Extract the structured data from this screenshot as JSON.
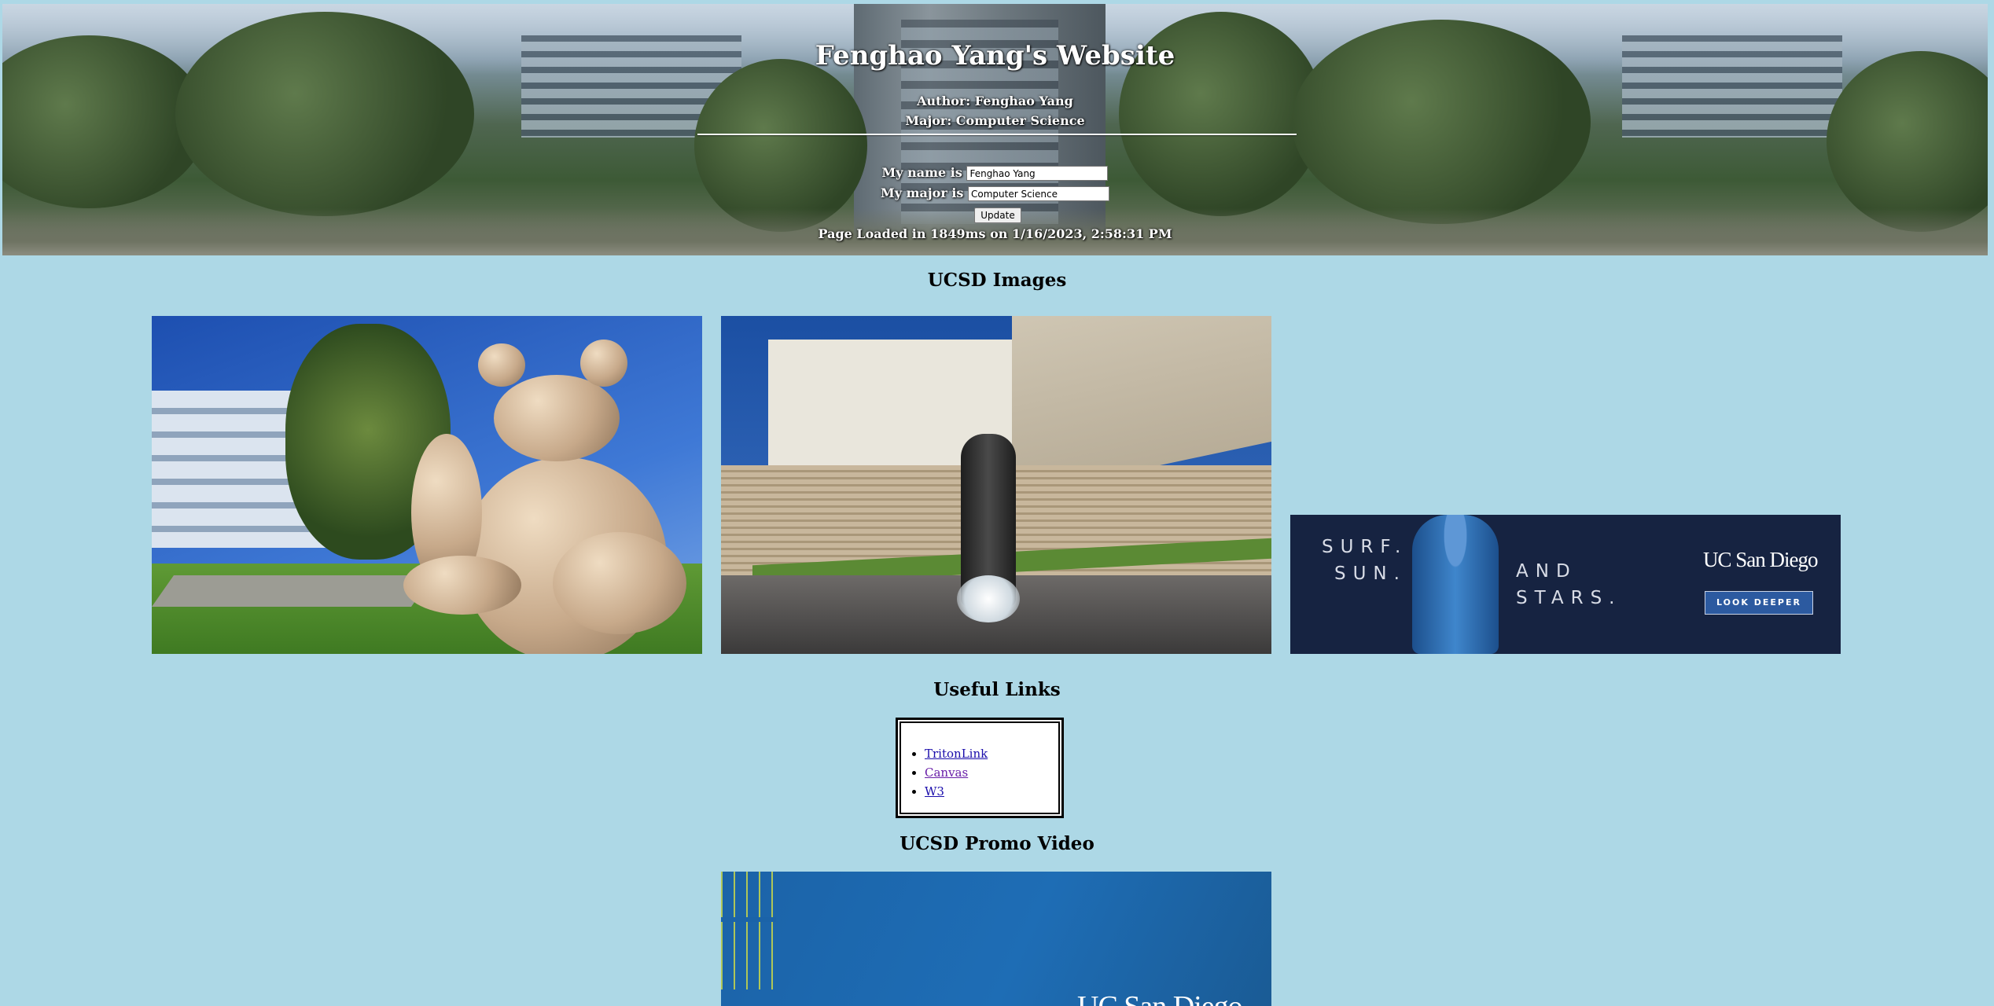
{
  "header": {
    "title": "Fenghao Yang's Website",
    "author": "Author: Fenghao Yang",
    "major": "Major: Computer Science",
    "form": {
      "name_label": "My name is",
      "name_value": "Fenghao Yang",
      "major_label": "My major is",
      "major_value": "Computer Science",
      "update_label": "Update"
    },
    "loaded_text": "Page Loaded in 1849ms on 1/16/2023, 2:58:31 PM"
  },
  "images_section": {
    "title": "UCSD Images",
    "ad": {
      "left_text_line1": "SURF.",
      "left_text_line2": "SUN.",
      "mid_text_line1": "AND",
      "mid_text_line2": "STARS.",
      "brand": "UC San Diego",
      "button": "LOOK DEEPER"
    }
  },
  "links_section": {
    "title": "Useful Links",
    "links": [
      "TritonLink",
      "Canvas",
      "W3"
    ]
  },
  "video_section": {
    "title": "UCSD Promo Video",
    "logo_text": "UC San Diego"
  },
  "colors": {
    "page_background": "#add8e6",
    "link": "#1a0dab",
    "link_visited": "#681da8",
    "ad_background": "#162341"
  }
}
